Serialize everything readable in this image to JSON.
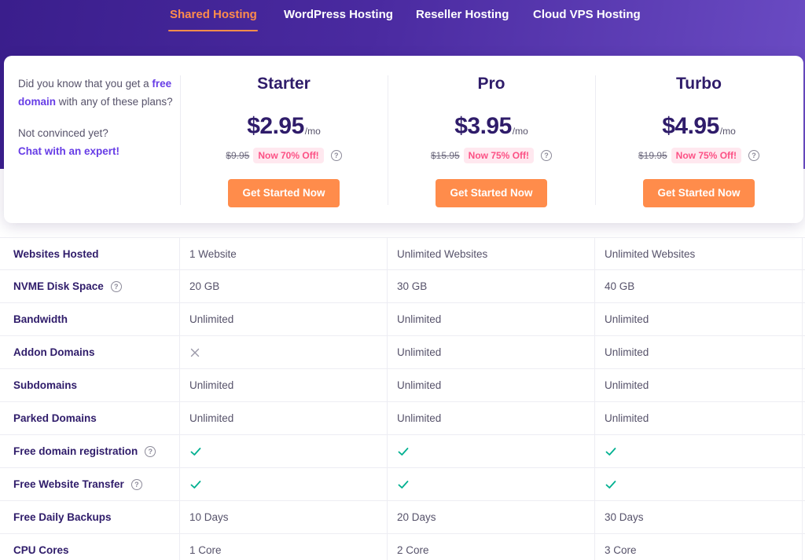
{
  "tabs": [
    {
      "label": "Shared Hosting",
      "active": true
    },
    {
      "label": "WordPress Hosting",
      "active": false
    },
    {
      "label": "Reseller Hosting",
      "active": false
    },
    {
      "label": "Cloud VPS Hosting",
      "active": false
    }
  ],
  "promo": {
    "line1_pre": "Did you know that you get a",
    "line1_link": "free domain",
    "line1_post": "with any of these plans?",
    "line2": "Not convinced yet?",
    "chat_link": "Chat with an expert!"
  },
  "plans": [
    {
      "name": "Starter",
      "price": "$2.95",
      "per": "/mo",
      "old_price": "$9.95",
      "discount": "Now 70% Off!",
      "cta": "Get Started Now"
    },
    {
      "name": "Pro",
      "price": "$3.95",
      "per": "/mo",
      "old_price": "$15.95",
      "discount": "Now 75% Off!",
      "cta": "Get Started Now"
    },
    {
      "name": "Turbo",
      "price": "$4.95",
      "per": "/mo",
      "old_price": "$19.95",
      "discount": "Now 75% Off!",
      "cta": "Get Started Now"
    }
  ],
  "features": [
    {
      "label": "Websites Hosted",
      "help": false,
      "values": [
        "1 Website",
        "Unlimited Websites",
        "Unlimited Websites"
      ]
    },
    {
      "label": "NVME Disk Space",
      "help": true,
      "values": [
        "20 GB",
        "30 GB",
        "40 GB"
      ]
    },
    {
      "label": "Bandwidth",
      "help": false,
      "values": [
        "Unlimited",
        "Unlimited",
        "Unlimited"
      ]
    },
    {
      "label": "Addon Domains",
      "help": false,
      "values": [
        "cross-icon",
        "Unlimited",
        "Unlimited"
      ]
    },
    {
      "label": "Subdomains",
      "help": false,
      "values": [
        "Unlimited",
        "Unlimited",
        "Unlimited"
      ]
    },
    {
      "label": "Parked Domains",
      "help": false,
      "values": [
        "Unlimited",
        "Unlimited",
        "Unlimited"
      ]
    },
    {
      "label": "Free domain registration",
      "help": true,
      "values": [
        "check-icon",
        "check-icon",
        "check-icon"
      ]
    },
    {
      "label": "Free Website Transfer",
      "help": true,
      "values": [
        "check-icon",
        "check-icon",
        "check-icon"
      ]
    },
    {
      "label": "Free Daily Backups",
      "help": false,
      "values": [
        "10 Days",
        "20 Days",
        "30 Days"
      ]
    },
    {
      "label": "CPU Cores",
      "help": false,
      "values": [
        "1 Core",
        "2 Core",
        "3 Core"
      ]
    }
  ],
  "colors": {
    "accent_orange": "#ff8c4b",
    "brand_purple": "#673de6",
    "heading_navy": "#2f1c6a",
    "discount_pink": "#fc5185",
    "check_green": "#00b090"
  }
}
